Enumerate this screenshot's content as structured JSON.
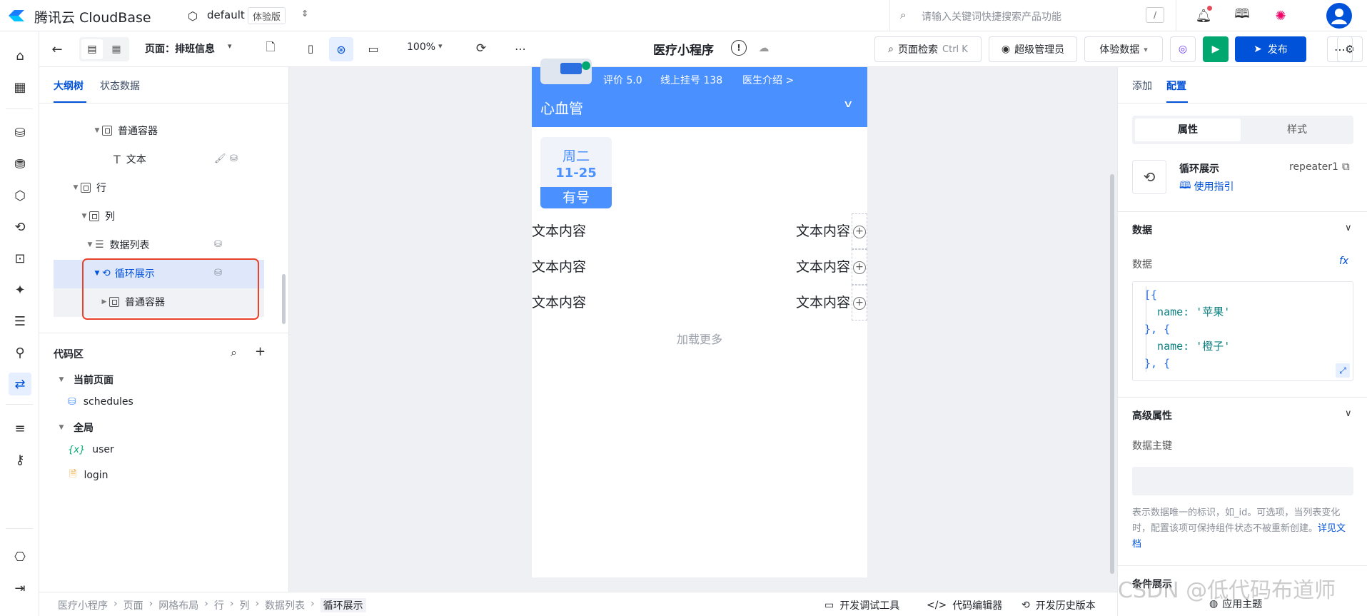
{
  "top": {
    "brand": "腾讯云 CloudBase",
    "env_name": "default",
    "env_badge": "体验版",
    "search_placeholder": "请输入关键词快捷搜索产品功能",
    "search_shortcut": "/"
  },
  "toolbar": {
    "page_label": "页面：排班信息",
    "zoom": "100%",
    "app_title": "医疗小程序",
    "page_search": "页面检索",
    "page_search_shortcut": "Ctrl K",
    "admin_label": "超级管理员",
    "data_mode": "体验数据",
    "publish_label": "发布"
  },
  "left": {
    "tabs": [
      "大纲树",
      "状态数据"
    ],
    "tree": [
      {
        "label": "普通容器",
        "indent": 3,
        "icon": "box"
      },
      {
        "label": "文本",
        "indent": 4,
        "icon": "text"
      },
      {
        "label": "行",
        "indent": 2,
        "icon": "box"
      },
      {
        "label": "列",
        "indent": 3,
        "icon": "box"
      },
      {
        "label": "数据列表",
        "indent": 4,
        "icon": "list"
      },
      {
        "label": "循环展示",
        "indent": 5,
        "icon": "repeat"
      },
      {
        "label": "普通容器",
        "indent": 6,
        "icon": "box"
      }
    ],
    "code_title": "代码区",
    "current_page": "当前页面",
    "schedules": "schedules",
    "global": "全局",
    "user": "user",
    "login": "login"
  },
  "phone": {
    "rating": "评价 5.0",
    "online": "线上挂号 138",
    "doctor_intro": "医生介绍 >",
    "department": "心血管",
    "weekday": "周二",
    "date": "11-25",
    "status": "有号",
    "rows": [
      {
        "left": "文本内容",
        "right": "文本内容"
      },
      {
        "left": "文本内容",
        "right": "文本内容"
      },
      {
        "left": "文本内容",
        "right": "文本内容"
      }
    ],
    "load_more": "加载更多"
  },
  "right": {
    "tabs": [
      "添加",
      "配置"
    ],
    "seg": [
      "属性",
      "样式"
    ],
    "comp_name": "循环展示",
    "comp_id": "repeater1",
    "guide": "使用指引",
    "data_section": "数据",
    "data_label": "数据",
    "code": [
      "[{",
      "  name: '苹果'",
      "}, {",
      "  name: '橙子'",
      "}, {"
    ],
    "advanced": "高级属性",
    "key_label": "数据主键",
    "key_help": "表示数据唯一的标识，如_id。可选项，当列表变化时，配置该项可保持组件状态不被重新创建。",
    "key_doc": "详见文档",
    "condition": "条件展示",
    "app_theme": "应用主题",
    "watermark": "CSDN @低代码布道师"
  },
  "status": {
    "breadcrumb": [
      "医疗小程序",
      "页面",
      "网格布局",
      "行",
      "列",
      "数据列表",
      "循环展示"
    ],
    "debug": "开发调试工具",
    "code_editor": "代码编辑器",
    "history": "开发历史版本"
  },
  "colors": {
    "brand": "#0052d9",
    "accent_blue": "#4a90ff",
    "green": "#00a870"
  }
}
